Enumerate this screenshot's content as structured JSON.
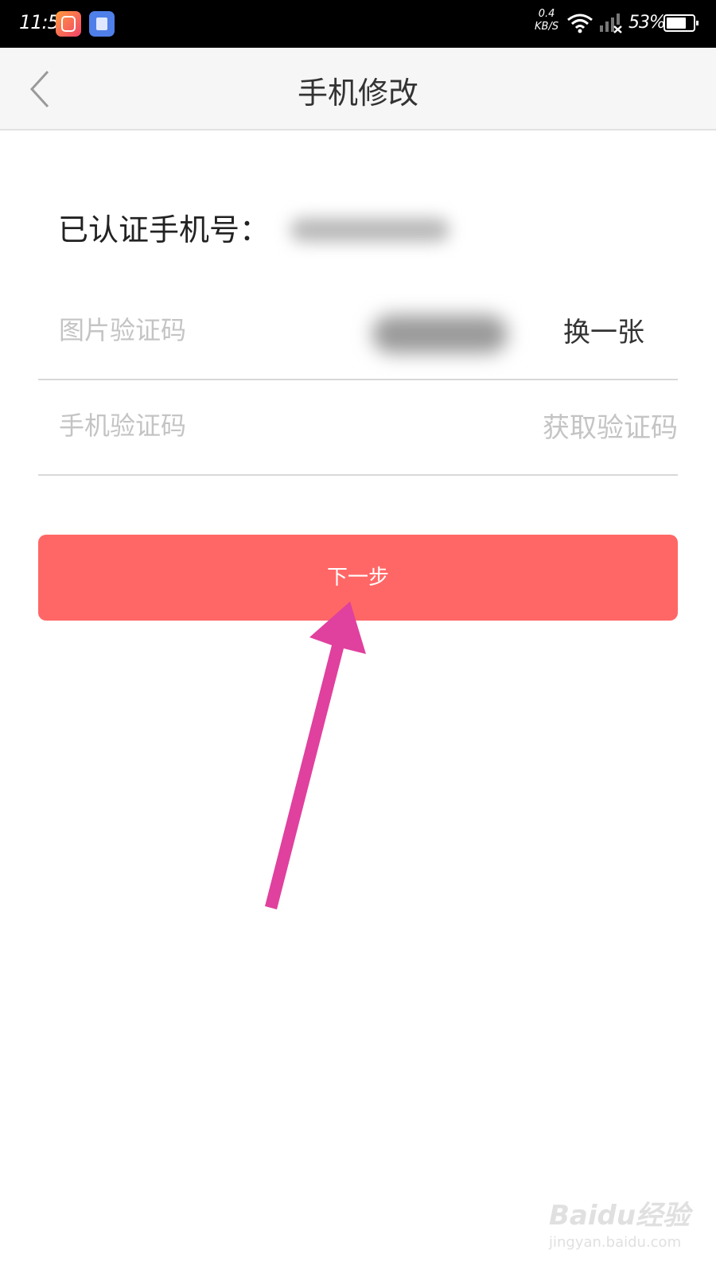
{
  "status_bar": {
    "time": "11:57",
    "network_speed_value": "0.4",
    "network_speed_unit": "KB/S",
    "battery_percent": "53%",
    "app_icons": [
      "video-app-icon",
      "shopping-bag-icon"
    ]
  },
  "nav": {
    "title": "手机修改",
    "back_icon": "chevron-left-icon"
  },
  "form": {
    "verified_phone_label": "已认证手机号：",
    "captcha_placeholder": "图片验证码",
    "refresh_captcha_label": "换一张",
    "sms_code_placeholder": "手机验证码",
    "get_code_label": "获取验证码",
    "next_button_label": "下一步"
  },
  "colors": {
    "primary_button": "#ff6766",
    "annotation_arrow": "#e0409e",
    "status_bar": "#000000",
    "nav_bar": "#f6f6f6"
  },
  "watermark": {
    "brand": "Baidu经验",
    "url": "jingyan.baidu.com"
  }
}
